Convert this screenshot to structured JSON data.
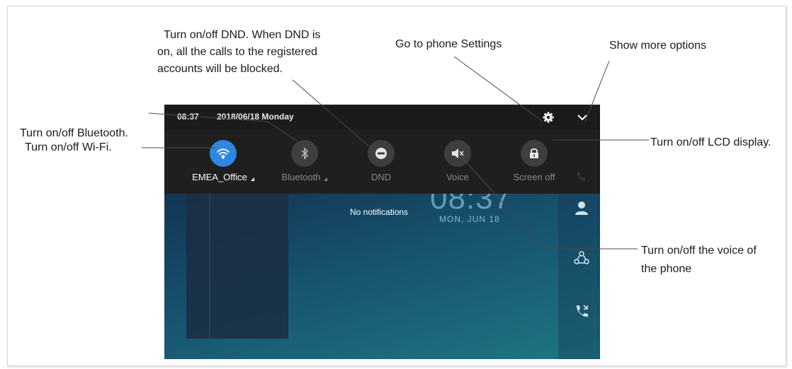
{
  "annotations": {
    "dnd_line1": "Turn on/off DND. When DND is",
    "dnd_line2": "on, all the calls to the registered",
    "dnd_line3": "accounts will be blocked.",
    "settings": "Go to phone Settings",
    "more": "Show more options",
    "bluetooth": "Turn on/off Bluetooth.",
    "wifi": "Turn on/off Wi-Fi.",
    "lcd": "Turn on/off LCD display.",
    "voice_line1": "Turn on/off the voice of",
    "voice_line2": "the phone"
  },
  "status_bar": {
    "time": "08:37",
    "date": "2018/06/18 Monday",
    "settings_icon": "gear-icon",
    "expand_icon": "chevron-down-icon"
  },
  "quick_settings": [
    {
      "label": "EMEA_Office",
      "icon": "wifi-icon",
      "active": true,
      "has_caret": true
    },
    {
      "label": "Bluetooth",
      "icon": "bluetooth-icon",
      "active": false,
      "has_caret": true
    },
    {
      "label": "DND",
      "icon": "dnd-icon",
      "active": false,
      "has_caret": false
    },
    {
      "label": "Voice",
      "icon": "speaker-muted-icon",
      "active": false,
      "has_caret": false
    },
    {
      "label": "Screen off",
      "icon": "lock-icon",
      "active": false,
      "has_caret": false
    }
  ],
  "home": {
    "notifications": "No notifications",
    "clock": "08:37",
    "clock_date": "MON, JUN 18"
  },
  "colors": {
    "accent": "#2f86e0",
    "statusbar": "#1b1b1b",
    "panel": "#1f1f1f"
  }
}
